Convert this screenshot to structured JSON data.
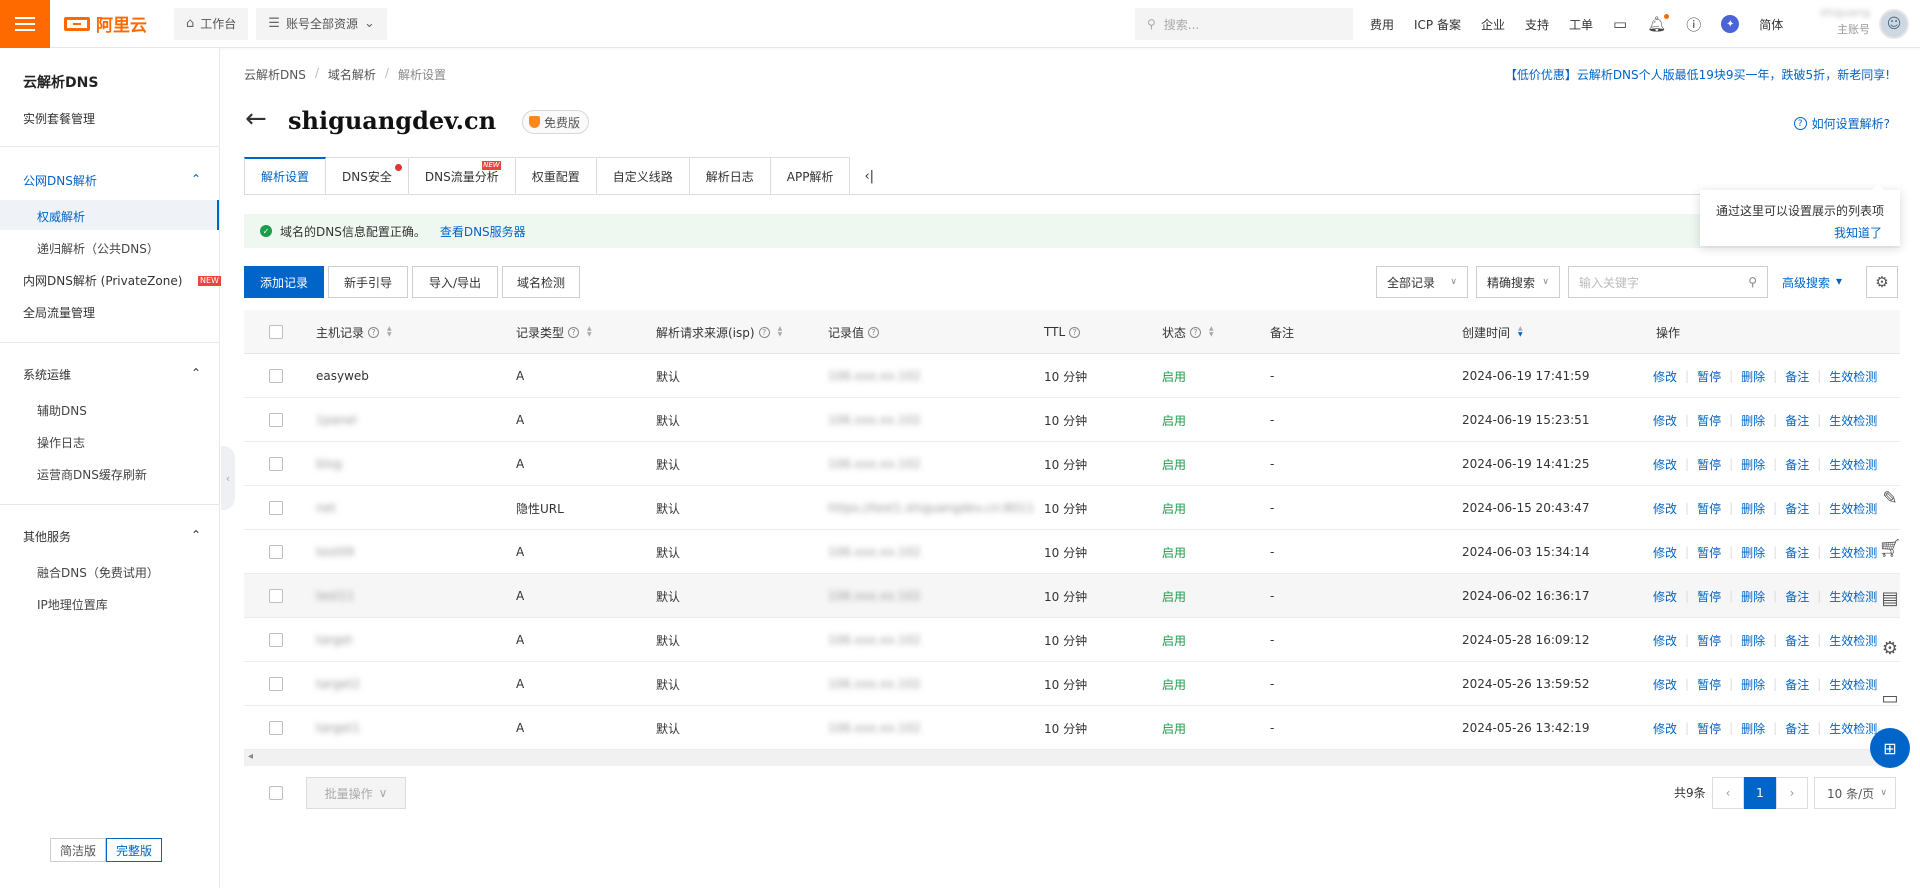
{
  "topbar": {
    "brand": "阿里云",
    "workbench": "工作台",
    "resources": "账号全部资源",
    "search_placeholder": "搜索...",
    "links": [
      "费用",
      "ICP 备案",
      "企业",
      "支持",
      "工单"
    ],
    "lang": "简体",
    "account_name": "shiguang",
    "account_type": "主账号"
  },
  "sidebar": {
    "title": "云解析DNS",
    "instance": "实例套餐管理",
    "group_public": "公网DNS解析",
    "public_items": [
      "权威解析",
      "递归解析（公共DNS）"
    ],
    "private_zone": "内网DNS解析 (PrivateZone)",
    "private_badge": "NEW",
    "global_traffic": "全局流量管理",
    "group_ops": "系统运维",
    "ops_items": [
      "辅助DNS",
      "操作日志",
      "运营商DNS缓存刷新"
    ],
    "group_other": "其他服务",
    "other_items": [
      "融合DNS（免费试用）",
      "IP地理位置库"
    ],
    "simple_version": "简洁版",
    "full_version": "完整版"
  },
  "breadcrumb": [
    "云解析DNS",
    "域名解析",
    "解析设置"
  ],
  "promo": "【低价优惠】云解析DNS个人版最低19块9买一年，跌破5折，新老同享!",
  "domain": "shiguangdev.cn",
  "edition_badge": "免费版",
  "howto": "如何设置解析?",
  "tabs": [
    "解析设置",
    "DNS安全",
    "DNS流量分析",
    "权重配置",
    "自定义线路",
    "解析日志",
    "APP解析"
  ],
  "tab_new_badge": "NEW",
  "notice": {
    "text": "域名的DNS信息配置正确。",
    "link": "查看DNS服务器"
  },
  "tip": {
    "text": "通过这里可以设置展示的列表项",
    "ok": "我知道了"
  },
  "toolbar": {
    "add": "添加记录",
    "guide": "新手引导",
    "import_export": "导入/导出",
    "check": "域名检测",
    "all_records": "全部记录",
    "precise": "精确搜索",
    "keyword_placeholder": "输入关键字",
    "advanced": "高级搜索"
  },
  "columns": [
    "主机记录",
    "记录类型",
    "解析请求来源(isp)",
    "记录值",
    "TTL",
    "状态",
    "备注",
    "创建时间",
    "操作"
  ],
  "rows": [
    {
      "host": "easyweb",
      "type": "A",
      "isp": "默认",
      "value": "106.xxx.xx.102",
      "ttl": "10 分钟",
      "status": "启用",
      "note": "-",
      "created": "2024-06-19 17:41:59"
    },
    {
      "host": "1panel",
      "type": "A",
      "isp": "默认",
      "value": "106.xxx.xx.102",
      "ttl": "10 分钟",
      "status": "启用",
      "note": "-",
      "created": "2024-06-19 15:23:51"
    },
    {
      "host": "blog",
      "type": "A",
      "isp": "默认",
      "value": "106.xxx.xx.102",
      "ttl": "10 分钟",
      "status": "启用",
      "note": "-",
      "created": "2024-06-19 14:41:25"
    },
    {
      "host": "net",
      "type": "隐性URL",
      "isp": "默认",
      "value": "https://test1.shiguangdev.cn:8011",
      "ttl": "10 分钟",
      "status": "启用",
      "note": "-",
      "created": "2024-06-15 20:43:47"
    },
    {
      "host": "test09",
      "type": "A",
      "isp": "默认",
      "value": "106.xxx.xx.102",
      "ttl": "10 分钟",
      "status": "启用",
      "note": "-",
      "created": "2024-06-03 15:34:14"
    },
    {
      "host": "test11",
      "type": "A",
      "isp": "默认",
      "value": "106.xxx.xx.102",
      "ttl": "10 分钟",
      "status": "启用",
      "note": "-",
      "created": "2024-06-02 16:36:17"
    },
    {
      "host": "target",
      "type": "A",
      "isp": "默认",
      "value": "106.xxx.xx.102",
      "ttl": "10 分钟",
      "status": "启用",
      "note": "-",
      "created": "2024-05-28 16:09:12"
    },
    {
      "host": "target2",
      "type": "A",
      "isp": "默认",
      "value": "106.xxx.xx.102",
      "ttl": "10 分钟",
      "status": "启用",
      "note": "-",
      "created": "2024-05-26 13:59:52"
    },
    {
      "host": "target1",
      "type": "A",
      "isp": "默认",
      "value": "106.xxx.xx.102",
      "ttl": "10 分钟",
      "status": "启用",
      "note": "-",
      "created": "2024-05-26 13:42:19"
    }
  ],
  "ops": [
    "修改",
    "暂停",
    "删除",
    "备注",
    "生效检测"
  ],
  "footer": {
    "batch": "批量操作",
    "total": "共9条",
    "page": "1",
    "page_size": "10 条/页"
  },
  "colors": {
    "accent": "#0064c8",
    "brand": "#ff6a00",
    "ok": "#1b9e4b"
  }
}
